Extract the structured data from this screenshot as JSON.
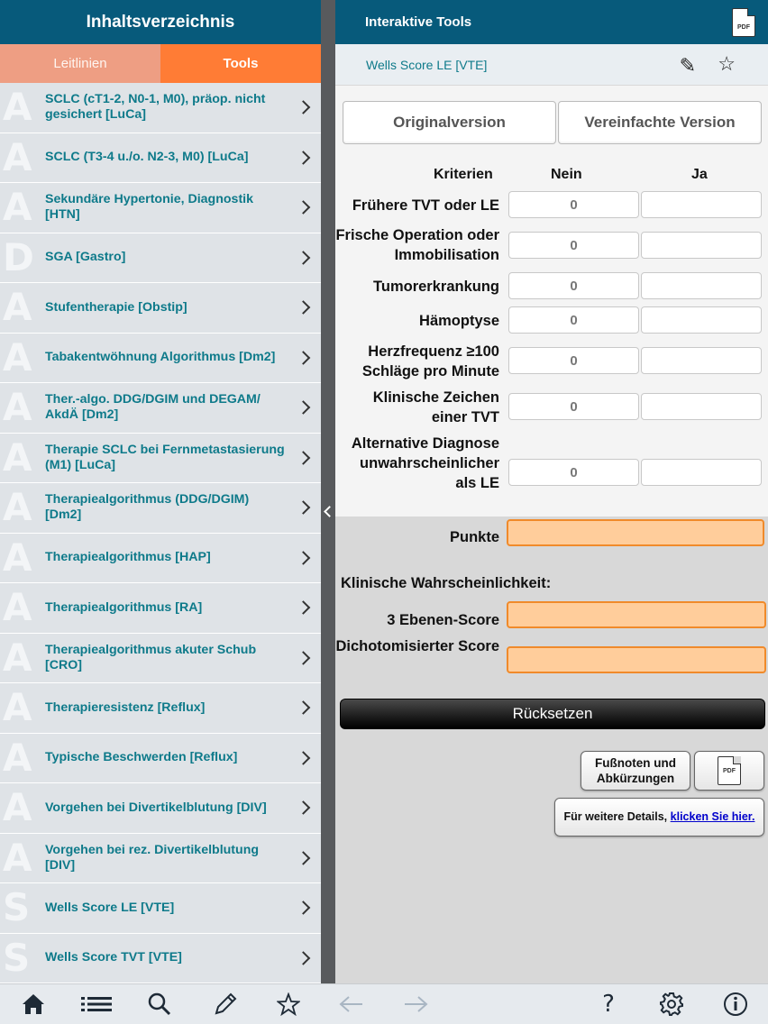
{
  "left": {
    "title": "Inhaltsverzeichnis",
    "tabs": [
      {
        "label": "Leitlinien",
        "active": false
      },
      {
        "label": "Tools",
        "active": true
      }
    ],
    "items": [
      {
        "letter": "A",
        "label": "SCLC (cT1-2, N0-1, M0), präop. nicht gesichert [LuCa]"
      },
      {
        "letter": "A",
        "label": "SCLC (T3-4 u./o. N2-3, M0) [LuCa]"
      },
      {
        "letter": "A",
        "label": "Sekundäre Hypertonie, Diagnostik [HTN]"
      },
      {
        "letter": "D",
        "label": "SGA [Gastro]"
      },
      {
        "letter": "A",
        "label": "Stufentherapie [Obstip]"
      },
      {
        "letter": "A",
        "label": "Tabakentwöhnung Algorithmus [Dm2]"
      },
      {
        "letter": "A",
        "label": "Ther.-algo. DDG/DGIM und DEGAM/ AkdÄ [Dm2]"
      },
      {
        "letter": "A",
        "label": "Therapie SCLC bei Fernmetastasierung (M1) [LuCa]"
      },
      {
        "letter": "A",
        "label": "Therapiealgorithmus (DDG/DGIM) [Dm2]"
      },
      {
        "letter": "A",
        "label": "Therapiealgorithmus [HAP]"
      },
      {
        "letter": "A",
        "label": "Therapiealgorithmus [RA]"
      },
      {
        "letter": "A",
        "label": "Therapiealgorithmus akuter Schub [CRO]"
      },
      {
        "letter": "A",
        "label": "Therapieresistenz [Reflux]"
      },
      {
        "letter": "A",
        "label": "Typische Beschwerden [Reflux]"
      },
      {
        "letter": "A",
        "label": "Vorgehen bei Divertikelblutung [DIV]"
      },
      {
        "letter": "A",
        "label": "Vorgehen bei rez. Divertikelblutung [DIV]"
      },
      {
        "letter": "S",
        "label": "Wells Score LE [VTE]"
      },
      {
        "letter": "S",
        "label": "Wells Score TVT [VTE]"
      }
    ]
  },
  "right": {
    "title": "Interaktive Tools",
    "pdf_label": "PDF",
    "subtitle": "Wells Score LE [VTE]",
    "segments": [
      "Originalversion",
      "Vereinfachte Version"
    ],
    "columns": {
      "criteria": "Kriterien",
      "no": "Nein",
      "yes": "Ja"
    },
    "criteria": [
      {
        "label": "Frühere TVT oder LE",
        "nein": "0",
        "ja": ""
      },
      {
        "label": "Frische Operation oder Immobilisation",
        "nein": "0",
        "ja": ""
      },
      {
        "label": "Tumorerkrankung",
        "nein": "0",
        "ja": ""
      },
      {
        "label": "Hämoptyse",
        "nein": "0",
        "ja": ""
      },
      {
        "label": "Herzfrequenz ≥100 Schläge pro Minute",
        "nein": "0",
        "ja": ""
      },
      {
        "label": "Klinische Zeichen einer TVT",
        "nein": "0",
        "ja": ""
      },
      {
        "label": "Alternative Diagnose unwahrscheinlicher als LE",
        "nein": "0",
        "ja": ""
      }
    ],
    "points_label": "Punkte",
    "points_value": "",
    "probability_heading": "Klinische Wahrscheinlichkeit:",
    "three_level_label": "3 Ebenen-Score",
    "three_level_value": "",
    "dichotomized_label": "Dichotomisierter Score",
    "dichotomized_value": "",
    "reset_label": "Rücksetzen",
    "footnotes_label": "Fußnoten und Abkürzungen",
    "details_prefix": "Für weitere Details, ",
    "details_link": "klicken Sie hier."
  },
  "bottombar": {
    "icons": [
      "home-icon",
      "list-icon",
      "search-icon",
      "pencil-icon",
      "star-icon",
      "back-arrow-icon",
      "forward-arrow-icon",
      "help-icon",
      "gear-icon",
      "info-icon"
    ]
  },
  "colors": {
    "header_blue": "#075a7b",
    "teal_text": "#0e7a8a",
    "tab_active": "#ff7c35",
    "tab_inactive": "#ee9e83",
    "orange_field": "#ffcd9b",
    "orange_border": "#f08a2a"
  }
}
